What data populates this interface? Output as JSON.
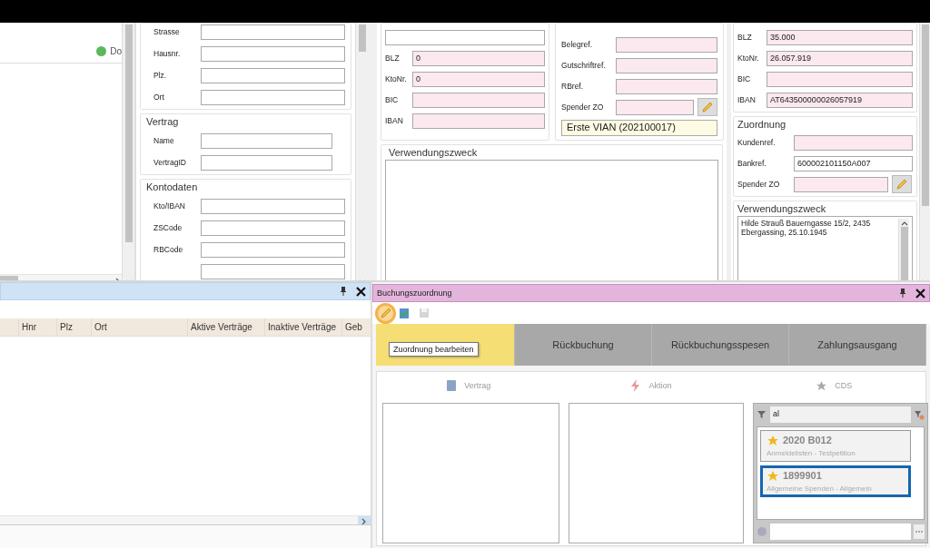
{
  "top_left_panel": {
    "add_button": "Do"
  },
  "address": {
    "fields": [
      "Strasse",
      "Hausnr.",
      "Plz.",
      "Ort"
    ]
  },
  "vertrag": {
    "title": "Vertrag",
    "fields": [
      "Name",
      "VertragID"
    ]
  },
  "kontodaten": {
    "title": "Kontodaten",
    "fields": [
      "Kto/IBAN",
      "ZSCode",
      "RBCode"
    ]
  },
  "bank_left": [
    {
      "label": "BLZ",
      "value": "0"
    },
    {
      "label": "KtoNr.",
      "value": "0"
    },
    {
      "label": "BIC"
    },
    {
      "label": "IBAN"
    }
  ],
  "refs": [
    {
      "label": "Belegref.",
      "kind": "text"
    },
    {
      "label": "Gutschriftref.",
      "kind": "text"
    },
    {
      "label": "RBref.",
      "kind": "text"
    },
    {
      "label": "Spender ZO",
      "kind": "picker"
    }
  ],
  "donor": "Erste VIAN (202100017)",
  "purpose_left": {
    "title": "Verwendungszweck"
  },
  "bank_right": [
    {
      "label": "BLZ",
      "value": "35.000"
    },
    {
      "label": "KtoNr.",
      "value": "26.057.919"
    },
    {
      "label": "BIC"
    },
    {
      "label": "IBAN",
      "value": "AT643500000026057919"
    }
  ],
  "zuordnung": {
    "title": "Zuordnung",
    "fields": [
      {
        "label": "Kundenref.",
        "kind": "text",
        "highlighted": true
      },
      {
        "label": "Bankref.",
        "kind": "text",
        "value": "600002101150A007",
        "highlighted": false
      },
      {
        "label": "Spender ZO",
        "kind": "picker",
        "highlighted": true
      }
    ]
  },
  "purpose_right": {
    "title": "Verwendungszweck",
    "text": "Hilde Strauß Bauerngasse 15/2, 2435 Ebergassing, 25.10.1945"
  },
  "search_panel": {
    "columns": [
      "Hnr",
      "Plz",
      "Ort",
      "Aktive Verträge",
      "Inaktive Verträge",
      "Geb"
    ]
  },
  "booking": {
    "title": "Buchungszuordnung",
    "toolbar": [
      {
        "kind": "edit",
        "highlighted": true,
        "disabled": false
      },
      {
        "kind": "confirm",
        "highlighted": false,
        "disabled": false
      },
      {
        "kind": "save",
        "highlighted": false,
        "disabled": true
      }
    ],
    "tooltip": "Zuordnung bearbeiten",
    "tabs": [
      {
        "selected": true
      },
      {
        "label": "Rückbuchung",
        "selected": false
      },
      {
        "label": "Rückbuchungsspesen",
        "selected": false
      },
      {
        "label": "Zahlungsausgang",
        "selected": false
      }
    ],
    "sections": [
      {
        "kind": "contract",
        "label": "Vertrag"
      },
      {
        "kind": "action",
        "label": "Aktion"
      },
      {
        "kind": "cds",
        "label": "CDS"
      }
    ],
    "cds": {
      "filter": "al",
      "items": [
        {
          "code": "2020 B012",
          "description": "Anmeldelisten - Testpetition",
          "selected": false
        },
        {
          "code": "1899901",
          "description": "Allgemeine Spenden - Allgemein",
          "selected": true
        }
      ]
    }
  }
}
